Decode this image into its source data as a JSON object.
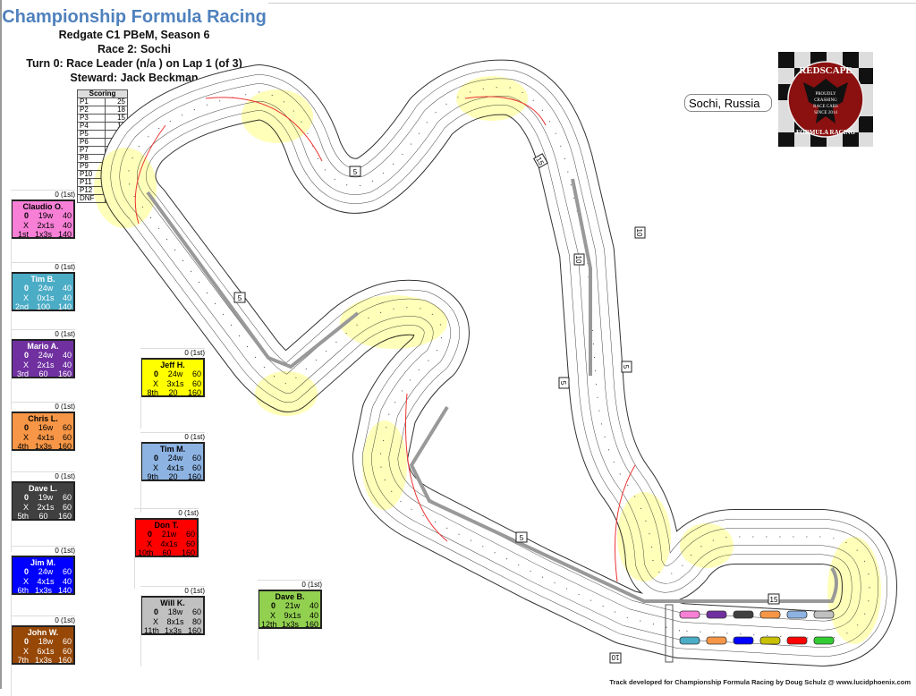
{
  "header": {
    "title": "Championship Formula Racing",
    "series": "Redgate C1 PBeM, Season 6",
    "race": "Race 2: Sochi",
    "turn": "Turn 0: Race Leader (n/a  ) on Lap 1 (of 3)",
    "steward": "Steward: Jack Beckman"
  },
  "scoring": {
    "title": "Scoring",
    "rows": [
      [
        "P1",
        "25"
      ],
      [
        "P2",
        "18"
      ],
      [
        "P3",
        "15"
      ],
      [
        "P4",
        "12"
      ],
      [
        "P5",
        "10"
      ],
      [
        "P6",
        "8"
      ],
      [
        "P7",
        "6"
      ],
      [
        "P8",
        "4"
      ],
      [
        "P9",
        "2"
      ],
      [
        "P10",
        "1"
      ],
      [
        "P11",
        "0"
      ],
      [
        "P12",
        "0"
      ],
      [
        "DNF",
        "0"
      ]
    ]
  },
  "location": "Sochi, Russia",
  "logo": {
    "text_top": "REDSCAPE",
    "text_mid": "PROUDLY CRASHING RACE CARS SINCE 2014",
    "text_bottom": "FORMULA RACING"
  },
  "drivers": [
    {
      "name": "Claudio O.",
      "pos": "0 (1st)",
      "color": "#f77fd6",
      "text": "#000",
      "r1": [
        "0",
        "19w",
        "40"
      ],
      "r2": [
        "X",
        "2x1s",
        "40"
      ],
      "r3": [
        "1st",
        "1x3s",
        "140"
      ]
    },
    {
      "name": "Tim B.",
      "pos": "0 (1st)",
      "color": "#4bacc6",
      "text": "#fff",
      "r1": [
        "0",
        "24w",
        "40"
      ],
      "r2": [
        "X",
        "0x1s",
        "40"
      ],
      "r3": [
        "2nd",
        "100",
        "140"
      ]
    },
    {
      "name": "Mario A.",
      "pos": "0 (1st)",
      "color": "#7030a0",
      "text": "#fff",
      "r1": [
        "0",
        "24w",
        "40"
      ],
      "r2": [
        "X",
        "2x1s",
        "40"
      ],
      "r3": [
        "3rd",
        "60",
        "160"
      ]
    },
    {
      "name": "Chris L.",
      "pos": "0 (1st)",
      "color": "#f79646",
      "text": "#000",
      "r1": [
        "0",
        "16w",
        "60"
      ],
      "r2": [
        "X",
        "4x1s",
        "60"
      ],
      "r3": [
        "4th",
        "1x3s",
        "160"
      ]
    },
    {
      "name": "Dave L.",
      "pos": "0 (1st)",
      "color": "#404040",
      "text": "#fff",
      "r1": [
        "0",
        "19w",
        "60"
      ],
      "r2": [
        "X",
        "2x1s",
        "60"
      ],
      "r3": [
        "5th",
        "60",
        "160"
      ]
    },
    {
      "name": "Jim M.",
      "pos": "0 (1st)",
      "color": "#0000ff",
      "text": "#fff",
      "r1": [
        "0",
        "24w",
        "60"
      ],
      "r2": [
        "X",
        "4x1s",
        "40"
      ],
      "r3": [
        "6th",
        "1x3s",
        "140"
      ]
    },
    {
      "name": "John W.",
      "pos": "0 (1st)",
      "color": "#974806",
      "text": "#fff",
      "r1": [
        "0",
        "18w",
        "60"
      ],
      "r2": [
        "X",
        "6x1s",
        "60"
      ],
      "r3": [
        "7th",
        "1x3s",
        "160"
      ]
    },
    {
      "name": "Jeff H.",
      "pos": "0 (1st)",
      "color": "#ffff00",
      "text": "#000",
      "r1": [
        "0",
        "24w",
        "60"
      ],
      "r2": [
        "X",
        "3x1s",
        "60"
      ],
      "r3": [
        "8th",
        "20",
        "160"
      ]
    },
    {
      "name": "Tim M.",
      "pos": "0 (1st)",
      "color": "#8db3e2",
      "text": "#000",
      "r1": [
        "0",
        "24w",
        "60"
      ],
      "r2": [
        "X",
        "4x1s",
        "60"
      ],
      "r3": [
        "9th",
        "20",
        "160"
      ]
    },
    {
      "name": "Don T.",
      "pos": "0 (1st)",
      "color": "#ff0000",
      "text": "#000",
      "r1": [
        "0",
        "21w",
        "60"
      ],
      "r2": [
        "X",
        "4x1s",
        "60"
      ],
      "r3": [
        "10th",
        "60",
        "160"
      ]
    },
    {
      "name": "Will K.",
      "pos": "0 (1st)",
      "color": "#c0c0c0",
      "text": "#000",
      "r1": [
        "0",
        "18w",
        "60"
      ],
      "r2": [
        "X",
        "8x1s",
        "80"
      ],
      "r3": [
        "11th",
        "1x3s",
        "160"
      ]
    },
    {
      "name": "Dave B.",
      "pos": "0 (1st)",
      "color": "#92d050",
      "text": "#000",
      "r1": [
        "0",
        "21w",
        "40"
      ],
      "r2": [
        "X",
        "9x1s",
        "40"
      ],
      "r3": [
        "12th",
        "1x3s",
        "160"
      ]
    }
  ],
  "track_markers": [
    "5",
    "5",
    "10",
    "10",
    "5",
    "5",
    "5",
    "15",
    "10",
    "15"
  ],
  "grid_cars": [
    "#f77fd6",
    "#7030a0",
    "#404040",
    "#f79646",
    "#8db3e2",
    "#c0c0c0",
    "#4bacc6",
    "#f79646",
    "#0000ff",
    "#c8c000",
    "#ff0000",
    "#33cc33"
  ],
  "footer": "Track developed for Championship Formula Racing by Doug Schulz @ www.lucidphoenix.com"
}
